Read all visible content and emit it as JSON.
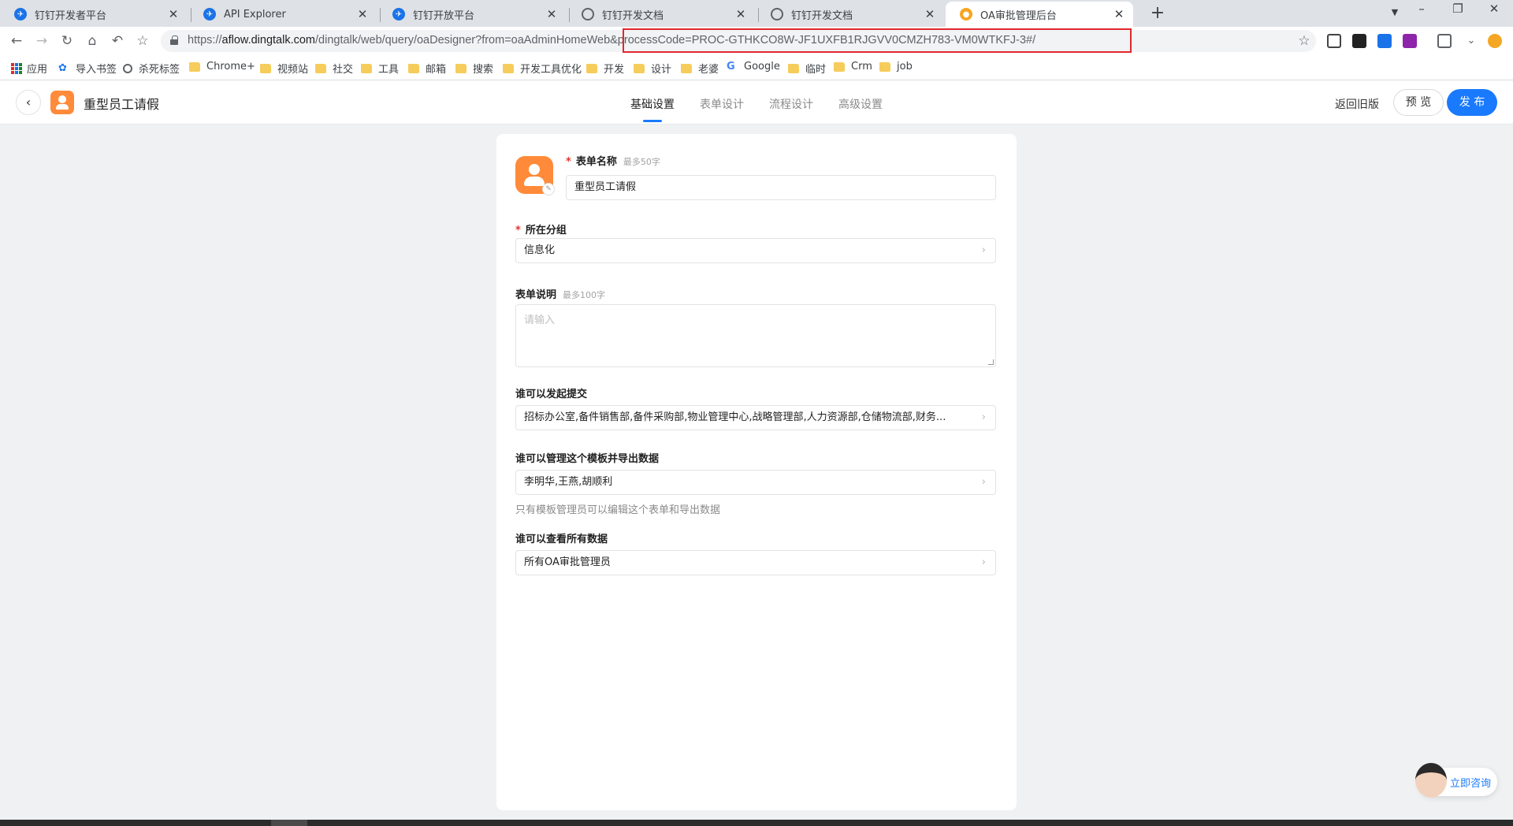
{
  "browser": {
    "tabs": [
      {
        "title": "钉钉开发者平台",
        "favicon": "blue"
      },
      {
        "title": "API Explorer",
        "favicon": "blue"
      },
      {
        "title": "钉钉开放平台",
        "favicon": "blue"
      },
      {
        "title": "钉钉开发文档",
        "favicon": "globe"
      },
      {
        "title": "钉钉开发文档",
        "favicon": "globe"
      },
      {
        "title": "OA审批管理后台",
        "favicon": "orange",
        "active": true
      }
    ],
    "url_prefix": "https://",
    "url_host": "aflow.dingtalk.com",
    "url_path": "/dingtalk/web/query/oaDesigner?from=oaAdminHomeWeb&processCode=PROC-GTHKCO8W-JF1UXFB1RJGVV0CMZH783-VM0WTKFJ-3#/",
    "highlight_color": "#e0282e",
    "bookmarks": [
      {
        "label": "应用",
        "icon": "apps-icon"
      },
      {
        "label": "导入书签",
        "icon": "gear-icon"
      },
      {
        "label": "杀死标签",
        "icon": "globe-icon"
      },
      {
        "label": "Chrome+",
        "icon": "folder-icon"
      },
      {
        "label": "视频站",
        "icon": "folder-icon"
      },
      {
        "label": "社交",
        "icon": "folder-icon"
      },
      {
        "label": "工具",
        "icon": "folder-icon"
      },
      {
        "label": "邮箱",
        "icon": "folder-icon"
      },
      {
        "label": "搜索",
        "icon": "folder-icon"
      },
      {
        "label": "开发工具优化",
        "icon": "folder-icon"
      },
      {
        "label": "开发",
        "icon": "folder-icon"
      },
      {
        "label": "设计",
        "icon": "folder-icon"
      },
      {
        "label": "老婆",
        "icon": "folder-icon"
      },
      {
        "label": "Google",
        "icon": "google-icon"
      },
      {
        "label": "临时",
        "icon": "folder-icon"
      },
      {
        "label": "Crm",
        "icon": "folder-icon"
      },
      {
        "label": "job",
        "icon": "folder-icon"
      }
    ]
  },
  "header": {
    "app_name": "重型员工请假",
    "tabs": [
      "基础设置",
      "表单设计",
      "流程设计",
      "高级设置"
    ],
    "active_tab": "基础设置",
    "old_version": "返回旧版",
    "preview": "预 览",
    "publish": "发 布",
    "accent": "#1a7afe"
  },
  "form": {
    "name_label": "表单名称",
    "name_hint": "最多50字",
    "name_value": "重型员工请假",
    "group_label": "所在分组",
    "group_value": "信息化",
    "desc_label": "表单说明",
    "desc_hint": "最多100字",
    "desc_placeholder": "请输入",
    "initiators_label": "谁可以发起提交",
    "initiators_value": "招标办公室,备件销售部,备件采购部,物业管理中心,战略管理部,人力资源部,仓储物流部,财务...",
    "managers_label": "谁可以管理这个模板并导出数据",
    "managers_value": "李明华,王燕,胡顺利",
    "managers_note": "只有模板管理员可以编辑这个表单和导出数据",
    "viewers_label": "谁可以查看所有数据",
    "viewers_value": "所有OA审批管理员"
  },
  "consult": {
    "label": "立即咨询"
  }
}
